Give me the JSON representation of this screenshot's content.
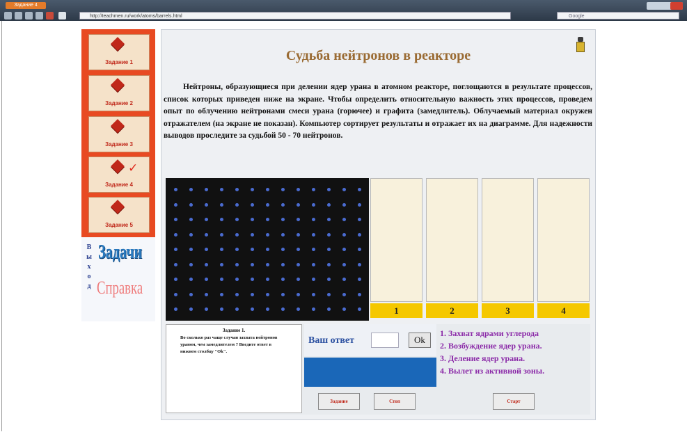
{
  "browser": {
    "tab_label": "Задание 4",
    "url": "http://teachmen.ru/work/atoms/barrels.html",
    "search_placeholder": "Google"
  },
  "sidebar": {
    "tasks": [
      {
        "label": "Задание 1",
        "completed": false
      },
      {
        "label": "Задание 2",
        "completed": false
      },
      {
        "label": "Задание 3",
        "completed": false
      },
      {
        "label": "Задание 4",
        "completed": true,
        "check": "✓"
      },
      {
        "label": "Задание 5",
        "completed": false
      }
    ],
    "exit_letters": [
      "В",
      "ы",
      "х",
      "о",
      "д"
    ],
    "zadachi_label": "Задачи",
    "spravka_label": "Справка"
  },
  "main": {
    "title": "Судьба нейтронов в реакторе",
    "description": "Нейтроны, образующиеся при делении ядер урана в атомном реакторе, поглощаются в результате процессов, список которых приведен ниже на экране. Чтобы определить относительную важность этих процессов, проведем опыт по облучению нейтронами смеси урана (горючее) и графита (замедлитель). Облучаемый материал окружен отражателем (на экране не показан). Компьютер сортирует результаты и отражает их на диаграмме. Для надежности выводов проследите за судьбой 50 - 70 нейтронов.",
    "columns": [
      "1",
      "2",
      "3",
      "4"
    ]
  },
  "bottom": {
    "task_title": "Задание 1.",
    "task_text": "Во сколько раз чаще случаи захвата нейтронов ураном, чем замедлителем ? Введите ответ в нижнем столбцу \"Ok\".",
    "answer_label": "Ваш ответ",
    "answer_value": "",
    "ok_label": "Ok",
    "btn_task": "Задание",
    "btn_stop": "Стоп",
    "btn_start": "Старт",
    "legend": [
      "1. Захват ядрами углерода",
      "2. Возбуждение ядер урана.",
      "3. Деление ядер урана.",
      "4. Вылет из активной зоны."
    ]
  },
  "colors": {
    "sidebar_bg": "#e84a22",
    "board_bg": "#111111",
    "dot": "#4a6bd0",
    "column_label_bg": "#f5c800",
    "answer_blue": "#1a67b8",
    "legend_text": "#8b2aa8",
    "title_text": "#9a6b33"
  },
  "icons": [
    "lock-icon",
    "diamond-icon",
    "checkmark-icon",
    "back-icon",
    "forward-icon",
    "reload-icon",
    "home-icon",
    "stop-icon",
    "favicon-icon",
    "search-icon"
  ]
}
